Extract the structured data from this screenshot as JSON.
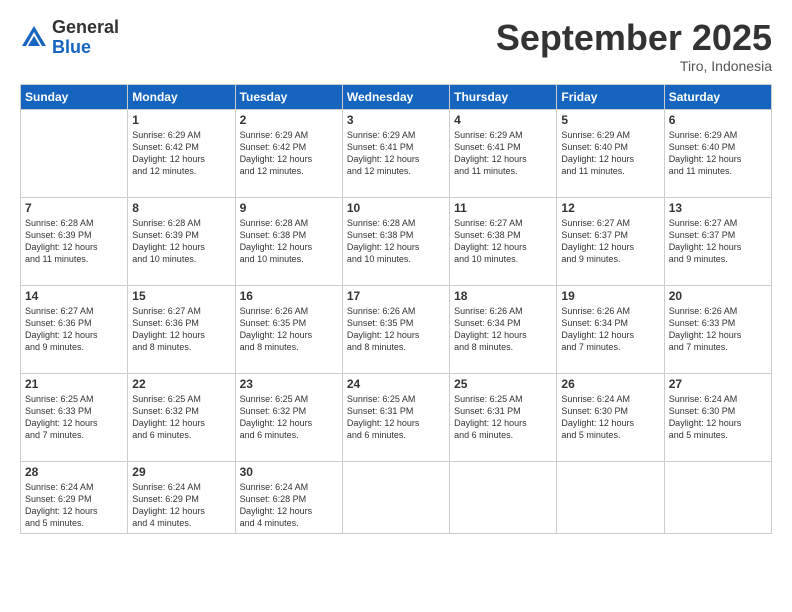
{
  "logo": {
    "general": "General",
    "blue": "Blue"
  },
  "header": {
    "month": "September 2025",
    "location": "Tiro, Indonesia"
  },
  "days_of_week": [
    "Sunday",
    "Monday",
    "Tuesday",
    "Wednesday",
    "Thursday",
    "Friday",
    "Saturday"
  ],
  "weeks": [
    [
      {
        "day": "",
        "info": ""
      },
      {
        "day": "1",
        "info": "Sunrise: 6:29 AM\nSunset: 6:42 PM\nDaylight: 12 hours\nand 12 minutes."
      },
      {
        "day": "2",
        "info": "Sunrise: 6:29 AM\nSunset: 6:42 PM\nDaylight: 12 hours\nand 12 minutes."
      },
      {
        "day": "3",
        "info": "Sunrise: 6:29 AM\nSunset: 6:41 PM\nDaylight: 12 hours\nand 12 minutes."
      },
      {
        "day": "4",
        "info": "Sunrise: 6:29 AM\nSunset: 6:41 PM\nDaylight: 12 hours\nand 11 minutes."
      },
      {
        "day": "5",
        "info": "Sunrise: 6:29 AM\nSunset: 6:40 PM\nDaylight: 12 hours\nand 11 minutes."
      },
      {
        "day": "6",
        "info": "Sunrise: 6:29 AM\nSunset: 6:40 PM\nDaylight: 12 hours\nand 11 minutes."
      }
    ],
    [
      {
        "day": "7",
        "info": "Sunrise: 6:28 AM\nSunset: 6:39 PM\nDaylight: 12 hours\nand 11 minutes."
      },
      {
        "day": "8",
        "info": "Sunrise: 6:28 AM\nSunset: 6:39 PM\nDaylight: 12 hours\nand 10 minutes."
      },
      {
        "day": "9",
        "info": "Sunrise: 6:28 AM\nSunset: 6:38 PM\nDaylight: 12 hours\nand 10 minutes."
      },
      {
        "day": "10",
        "info": "Sunrise: 6:28 AM\nSunset: 6:38 PM\nDaylight: 12 hours\nand 10 minutes."
      },
      {
        "day": "11",
        "info": "Sunrise: 6:27 AM\nSunset: 6:38 PM\nDaylight: 12 hours\nand 10 minutes."
      },
      {
        "day": "12",
        "info": "Sunrise: 6:27 AM\nSunset: 6:37 PM\nDaylight: 12 hours\nand 9 minutes."
      },
      {
        "day": "13",
        "info": "Sunrise: 6:27 AM\nSunset: 6:37 PM\nDaylight: 12 hours\nand 9 minutes."
      }
    ],
    [
      {
        "day": "14",
        "info": "Sunrise: 6:27 AM\nSunset: 6:36 PM\nDaylight: 12 hours\nand 9 minutes."
      },
      {
        "day": "15",
        "info": "Sunrise: 6:27 AM\nSunset: 6:36 PM\nDaylight: 12 hours\nand 8 minutes."
      },
      {
        "day": "16",
        "info": "Sunrise: 6:26 AM\nSunset: 6:35 PM\nDaylight: 12 hours\nand 8 minutes."
      },
      {
        "day": "17",
        "info": "Sunrise: 6:26 AM\nSunset: 6:35 PM\nDaylight: 12 hours\nand 8 minutes."
      },
      {
        "day": "18",
        "info": "Sunrise: 6:26 AM\nSunset: 6:34 PM\nDaylight: 12 hours\nand 8 minutes."
      },
      {
        "day": "19",
        "info": "Sunrise: 6:26 AM\nSunset: 6:34 PM\nDaylight: 12 hours\nand 7 minutes."
      },
      {
        "day": "20",
        "info": "Sunrise: 6:26 AM\nSunset: 6:33 PM\nDaylight: 12 hours\nand 7 minutes."
      }
    ],
    [
      {
        "day": "21",
        "info": "Sunrise: 6:25 AM\nSunset: 6:33 PM\nDaylight: 12 hours\nand 7 minutes."
      },
      {
        "day": "22",
        "info": "Sunrise: 6:25 AM\nSunset: 6:32 PM\nDaylight: 12 hours\nand 6 minutes."
      },
      {
        "day": "23",
        "info": "Sunrise: 6:25 AM\nSunset: 6:32 PM\nDaylight: 12 hours\nand 6 minutes."
      },
      {
        "day": "24",
        "info": "Sunrise: 6:25 AM\nSunset: 6:31 PM\nDaylight: 12 hours\nand 6 minutes."
      },
      {
        "day": "25",
        "info": "Sunrise: 6:25 AM\nSunset: 6:31 PM\nDaylight: 12 hours\nand 6 minutes."
      },
      {
        "day": "26",
        "info": "Sunrise: 6:24 AM\nSunset: 6:30 PM\nDaylight: 12 hours\nand 5 minutes."
      },
      {
        "day": "27",
        "info": "Sunrise: 6:24 AM\nSunset: 6:30 PM\nDaylight: 12 hours\nand 5 minutes."
      }
    ],
    [
      {
        "day": "28",
        "info": "Sunrise: 6:24 AM\nSunset: 6:29 PM\nDaylight: 12 hours\nand 5 minutes."
      },
      {
        "day": "29",
        "info": "Sunrise: 6:24 AM\nSunset: 6:29 PM\nDaylight: 12 hours\nand 4 minutes."
      },
      {
        "day": "30",
        "info": "Sunrise: 6:24 AM\nSunset: 6:28 PM\nDaylight: 12 hours\nand 4 minutes."
      },
      {
        "day": "",
        "info": ""
      },
      {
        "day": "",
        "info": ""
      },
      {
        "day": "",
        "info": ""
      },
      {
        "day": "",
        "info": ""
      }
    ]
  ]
}
